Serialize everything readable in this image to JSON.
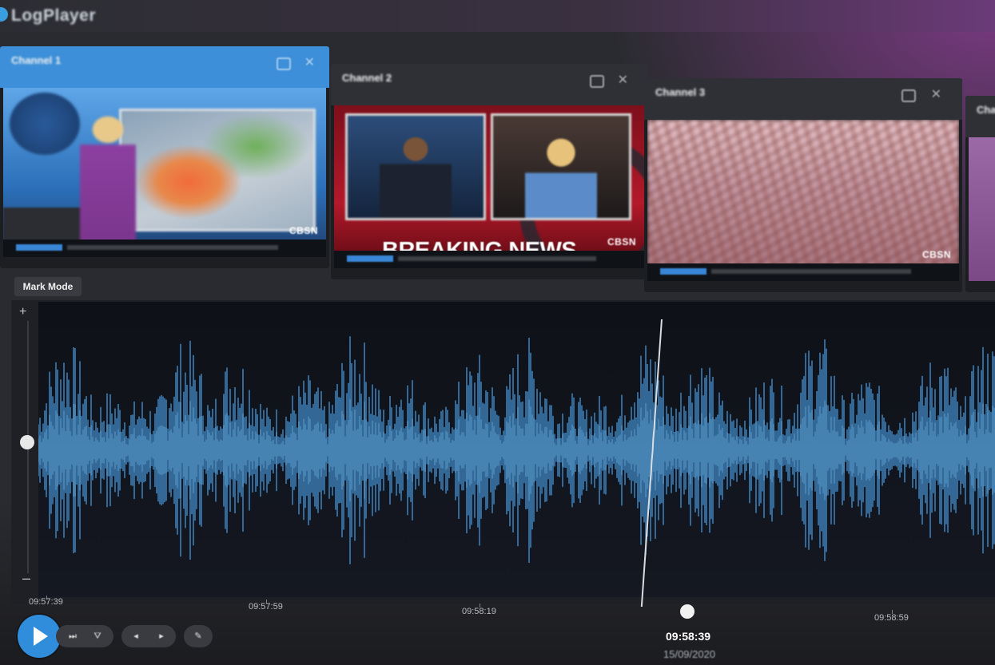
{
  "app": {
    "title": "LogPlayer"
  },
  "channels": [
    {
      "name": "Channel 1",
      "meta": "",
      "active": true,
      "ticker_text": "",
      "logo": "CBSN"
    },
    {
      "name": "Channel 2",
      "meta": "",
      "active": false,
      "headline": "BREAKING NEWS",
      "logo": "CBSN"
    },
    {
      "name": "Channel 3",
      "meta": "",
      "active": false,
      "logo": "CBSN"
    },
    {
      "name": "Channel",
      "meta": "",
      "active": false
    }
  ],
  "mark_mode": {
    "label": "Mark Mode"
  },
  "zoom": {
    "plus": "+",
    "minus": "–",
    "level": 0.5
  },
  "timeline": {
    "ticks": [
      "09:57:39",
      "09:57:59",
      "09:58:19",
      "09:58:59"
    ],
    "current_time": "09:58:39",
    "current_date": "15/09/2020",
    "playhead_fraction": 0.67
  },
  "controls": {
    "play_icon": "play-icon",
    "buttons": [
      "skip-forward-icon",
      "antenna-icon",
      "previous-mark-icon",
      "next-mark-icon",
      "clip-icon"
    ],
    "glyphs": [
      "⏭",
      "⛛",
      "◂",
      "▸",
      "✎"
    ]
  },
  "colors": {
    "accent": "#2f8ddb",
    "waveform": "#3c7db5",
    "waveform_light": "#5aa3d9",
    "panel_bg": "#1f2025",
    "breaking_red": "#b3192a"
  }
}
